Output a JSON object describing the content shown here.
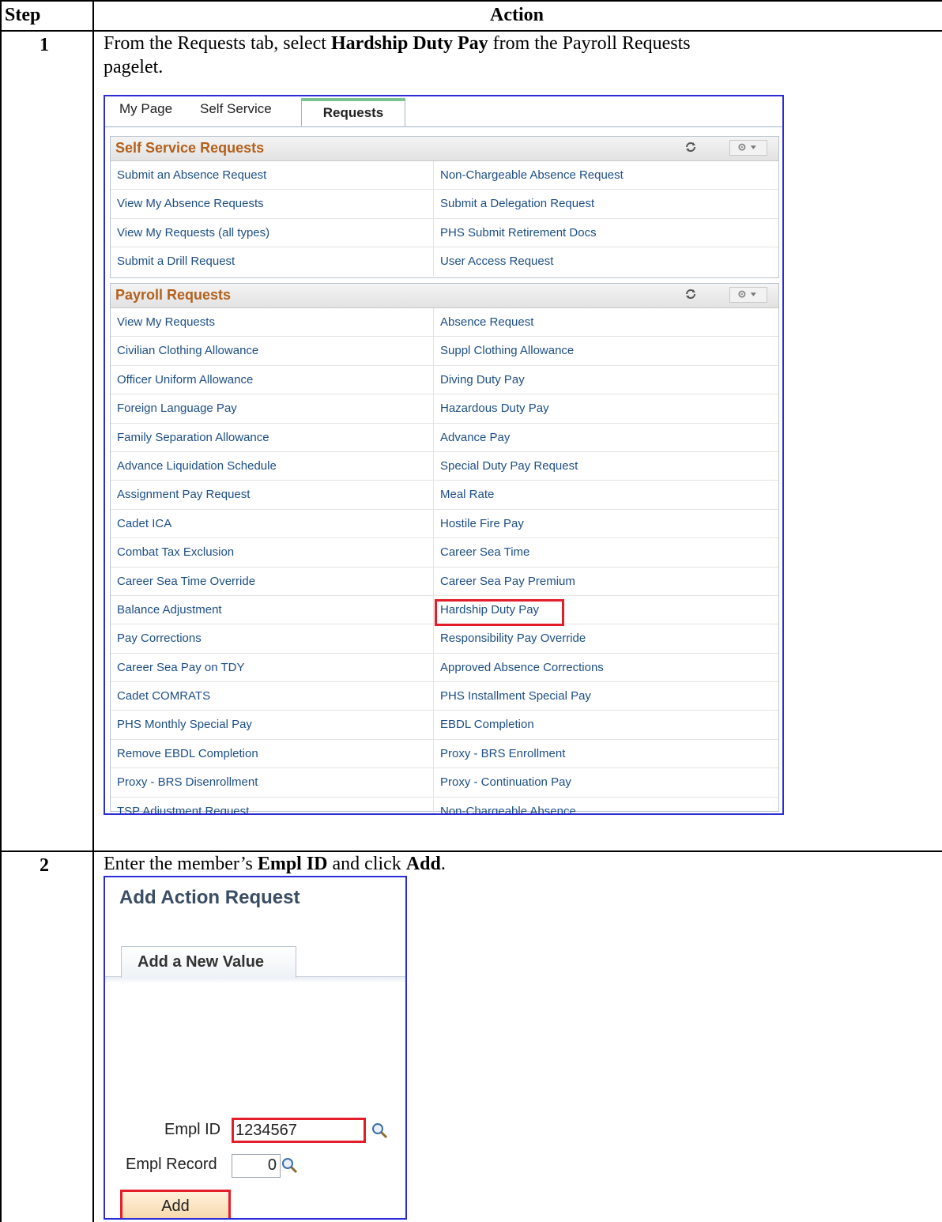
{
  "table": {
    "header_step": "Step",
    "header_action": "Action"
  },
  "step1": {
    "number": "1",
    "text_prefix": "From the Requests tab, select ",
    "text_bold": "Hardship Duty Pay",
    "text_suffix_line1": " from the Payroll Requests",
    "text_line2": "pagelet."
  },
  "portal": {
    "tabs": [
      "My Page",
      "Self Service",
      "Requests"
    ],
    "self_service": {
      "title": "Self Service Requests",
      "rows": [
        [
          "Submit an Absence Request",
          "Non-Chargeable Absence Request"
        ],
        [
          "View My Absence Requests",
          "Submit a Delegation Request"
        ],
        [
          "View My Requests (all types)",
          "PHS Submit Retirement Docs"
        ],
        [
          "Submit a Drill Request",
          "User Access Request"
        ]
      ]
    },
    "payroll": {
      "title": "Payroll Requests",
      "rows": [
        [
          "View My Requests",
          "Absence Request"
        ],
        [
          "Civilian Clothing Allowance",
          "Suppl Clothing Allowance"
        ],
        [
          "Officer Uniform Allowance",
          "Diving Duty Pay"
        ],
        [
          "Foreign Language Pay",
          "Hazardous Duty Pay"
        ],
        [
          "Family Separation Allowance",
          "Advance Pay"
        ],
        [
          "Advance Liquidation Schedule",
          "Special Duty Pay Request"
        ],
        [
          "Assignment Pay Request",
          "Meal Rate"
        ],
        [
          "Cadet ICA",
          "Hostile Fire Pay"
        ],
        [
          "Combat Tax Exclusion",
          "Career Sea Time"
        ],
        [
          "Career Sea Time Override",
          "Career Sea Pay Premium"
        ],
        [
          "Balance Adjustment",
          "Hardship Duty Pay"
        ],
        [
          "Pay Corrections",
          "Responsibility Pay Override"
        ],
        [
          "Career Sea Pay on TDY",
          "Approved Absence Corrections"
        ],
        [
          "Cadet COMRATS",
          "PHS Installment Special Pay"
        ],
        [
          "PHS Monthly Special Pay",
          "EBDL Completion"
        ],
        [
          "Remove EBDL Completion",
          "Proxy - BRS Enrollment"
        ],
        [
          "Proxy - BRS Disenrollment",
          "Proxy - Continuation Pay"
        ],
        [
          "TSP Adjustment Request",
          "Non-Chargeable Absence"
        ]
      ]
    }
  },
  "step2": {
    "number": "2",
    "text_prefix": "Enter the member’s ",
    "text_bold1": "Empl ID",
    "text_mid": " and click ",
    "text_bold2": "Add",
    "text_suffix": "."
  },
  "add_action": {
    "title": "Add Action Request",
    "tab_label": "Add a New Value",
    "empl_id_label": "Empl ID",
    "empl_id_value": "1234567",
    "empl_record_label": "Empl Record",
    "empl_record_value": "0",
    "add_button": "Add"
  },
  "colors": {
    "highlight": "#e41d2a",
    "screenshot_border": "#2b2bd8",
    "pagelet_title": "#b5601b",
    "link": "#1d4e85"
  }
}
